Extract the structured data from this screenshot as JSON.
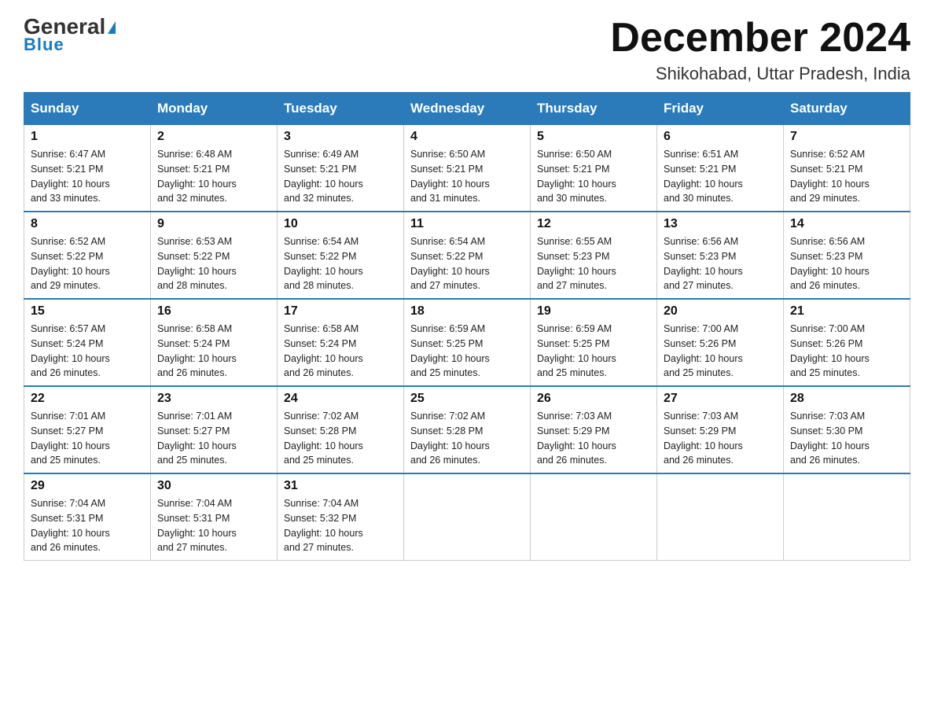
{
  "logo": {
    "name_black": "General",
    "name_blue": "Blue",
    "triangle_color": "#1a7abf"
  },
  "title": {
    "month_year": "December 2024",
    "location": "Shikohabad, Uttar Pradesh, India"
  },
  "days_of_week": [
    "Sunday",
    "Monday",
    "Tuesday",
    "Wednesday",
    "Thursday",
    "Friday",
    "Saturday"
  ],
  "weeks": [
    [
      {
        "day": "1",
        "sunrise": "6:47 AM",
        "sunset": "5:21 PM",
        "daylight": "10 hours and 33 minutes."
      },
      {
        "day": "2",
        "sunrise": "6:48 AM",
        "sunset": "5:21 PM",
        "daylight": "10 hours and 32 minutes."
      },
      {
        "day": "3",
        "sunrise": "6:49 AM",
        "sunset": "5:21 PM",
        "daylight": "10 hours and 32 minutes."
      },
      {
        "day": "4",
        "sunrise": "6:50 AM",
        "sunset": "5:21 PM",
        "daylight": "10 hours and 31 minutes."
      },
      {
        "day": "5",
        "sunrise": "6:50 AM",
        "sunset": "5:21 PM",
        "daylight": "10 hours and 30 minutes."
      },
      {
        "day": "6",
        "sunrise": "6:51 AM",
        "sunset": "5:21 PM",
        "daylight": "10 hours and 30 minutes."
      },
      {
        "day": "7",
        "sunrise": "6:52 AM",
        "sunset": "5:21 PM",
        "daylight": "10 hours and 29 minutes."
      }
    ],
    [
      {
        "day": "8",
        "sunrise": "6:52 AM",
        "sunset": "5:22 PM",
        "daylight": "10 hours and 29 minutes."
      },
      {
        "day": "9",
        "sunrise": "6:53 AM",
        "sunset": "5:22 PM",
        "daylight": "10 hours and 28 minutes."
      },
      {
        "day": "10",
        "sunrise": "6:54 AM",
        "sunset": "5:22 PM",
        "daylight": "10 hours and 28 minutes."
      },
      {
        "day": "11",
        "sunrise": "6:54 AM",
        "sunset": "5:22 PM",
        "daylight": "10 hours and 27 minutes."
      },
      {
        "day": "12",
        "sunrise": "6:55 AM",
        "sunset": "5:23 PM",
        "daylight": "10 hours and 27 minutes."
      },
      {
        "day": "13",
        "sunrise": "6:56 AM",
        "sunset": "5:23 PM",
        "daylight": "10 hours and 27 minutes."
      },
      {
        "day": "14",
        "sunrise": "6:56 AM",
        "sunset": "5:23 PM",
        "daylight": "10 hours and 26 minutes."
      }
    ],
    [
      {
        "day": "15",
        "sunrise": "6:57 AM",
        "sunset": "5:24 PM",
        "daylight": "10 hours and 26 minutes."
      },
      {
        "day": "16",
        "sunrise": "6:58 AM",
        "sunset": "5:24 PM",
        "daylight": "10 hours and 26 minutes."
      },
      {
        "day": "17",
        "sunrise": "6:58 AM",
        "sunset": "5:24 PM",
        "daylight": "10 hours and 26 minutes."
      },
      {
        "day": "18",
        "sunrise": "6:59 AM",
        "sunset": "5:25 PM",
        "daylight": "10 hours and 25 minutes."
      },
      {
        "day": "19",
        "sunrise": "6:59 AM",
        "sunset": "5:25 PM",
        "daylight": "10 hours and 25 minutes."
      },
      {
        "day": "20",
        "sunrise": "7:00 AM",
        "sunset": "5:26 PM",
        "daylight": "10 hours and 25 minutes."
      },
      {
        "day": "21",
        "sunrise": "7:00 AM",
        "sunset": "5:26 PM",
        "daylight": "10 hours and 25 minutes."
      }
    ],
    [
      {
        "day": "22",
        "sunrise": "7:01 AM",
        "sunset": "5:27 PM",
        "daylight": "10 hours and 25 minutes."
      },
      {
        "day": "23",
        "sunrise": "7:01 AM",
        "sunset": "5:27 PM",
        "daylight": "10 hours and 25 minutes."
      },
      {
        "day": "24",
        "sunrise": "7:02 AM",
        "sunset": "5:28 PM",
        "daylight": "10 hours and 25 minutes."
      },
      {
        "day": "25",
        "sunrise": "7:02 AM",
        "sunset": "5:28 PM",
        "daylight": "10 hours and 26 minutes."
      },
      {
        "day": "26",
        "sunrise": "7:03 AM",
        "sunset": "5:29 PM",
        "daylight": "10 hours and 26 minutes."
      },
      {
        "day": "27",
        "sunrise": "7:03 AM",
        "sunset": "5:29 PM",
        "daylight": "10 hours and 26 minutes."
      },
      {
        "day": "28",
        "sunrise": "7:03 AM",
        "sunset": "5:30 PM",
        "daylight": "10 hours and 26 minutes."
      }
    ],
    [
      {
        "day": "29",
        "sunrise": "7:04 AM",
        "sunset": "5:31 PM",
        "daylight": "10 hours and 26 minutes."
      },
      {
        "day": "30",
        "sunrise": "7:04 AM",
        "sunset": "5:31 PM",
        "daylight": "10 hours and 27 minutes."
      },
      {
        "day": "31",
        "sunrise": "7:04 AM",
        "sunset": "5:32 PM",
        "daylight": "10 hours and 27 minutes."
      },
      null,
      null,
      null,
      null
    ]
  ],
  "labels": {
    "sunrise": "Sunrise:",
    "sunset": "Sunset:",
    "daylight": "Daylight:"
  }
}
